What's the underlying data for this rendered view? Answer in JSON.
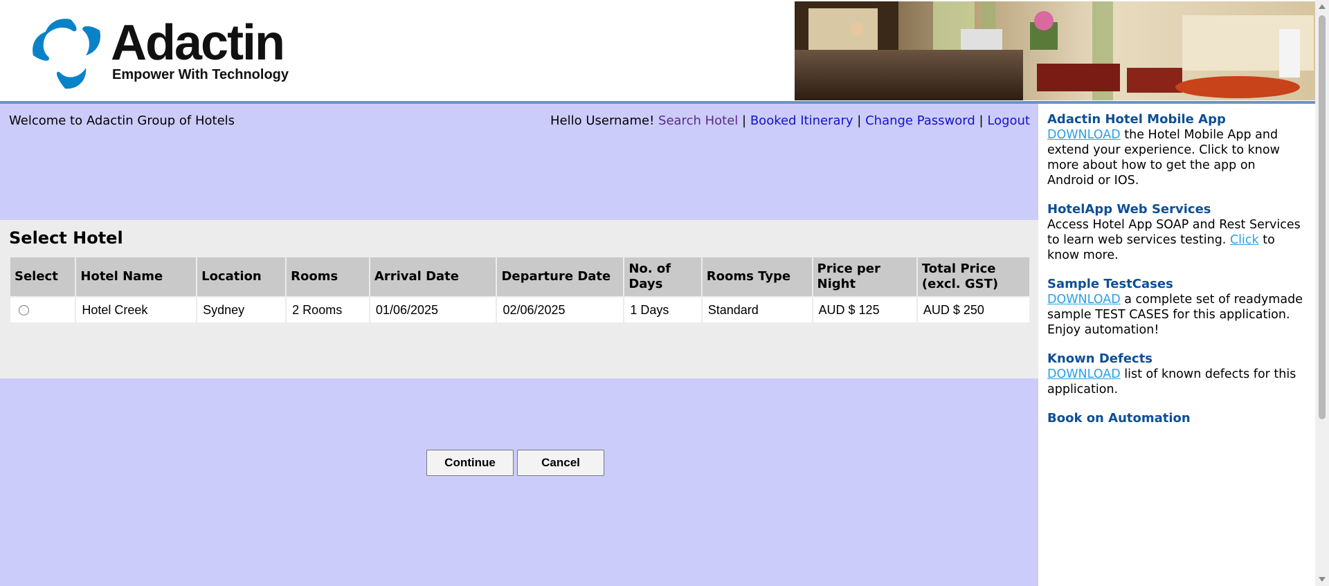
{
  "brand": {
    "name": "Adactin",
    "tagline": "Empower With Technology"
  },
  "header": {
    "welcome": "Welcome to Adactin Group of Hotels",
    "greeting": "Hello Username!",
    "nav": {
      "search_hotel": "Search Hotel",
      "booked_itinerary": "Booked Itinerary",
      "change_password": "Change Password",
      "logout": "Logout",
      "separator": "|"
    }
  },
  "select_hotel": {
    "title": "Select Hotel",
    "columns": {
      "select": "Select",
      "hotel_name": "Hotel Name",
      "location": "Location",
      "rooms": "Rooms",
      "arrival_date": "Arrival Date",
      "departure_date": "Departure Date",
      "no_of_days_1": "No. of",
      "no_of_days_2": "Days",
      "rooms_type": "Rooms Type",
      "price_per_night_1": "Price per",
      "price_per_night_2": "Night",
      "total_price_1": "Total Price",
      "total_price_2": "(excl. GST)"
    },
    "rows": [
      {
        "hotel_name": "Hotel Creek",
        "location": "Sydney",
        "rooms": "2 Rooms",
        "arrival_date": "01/06/2025",
        "departure_date": "02/06/2025",
        "no_of_days": "1 Days",
        "rooms_type": "Standard",
        "price_per_night": "AUD $ 125",
        "total_price": "AUD $ 250"
      }
    ],
    "buttons": {
      "continue": "Continue",
      "cancel": "Cancel"
    }
  },
  "sidebar": {
    "mobile_app": {
      "title": "Adactin Hotel Mobile App",
      "link": "DOWNLOAD",
      "text": " the Hotel Mobile App and extend your experience. Click to know more about how to get the app on Android or IOS."
    },
    "web_services": {
      "title": "HotelApp Web Services",
      "text_before": "Access Hotel App SOAP and Rest Services to learn web services testing. ",
      "link": "Click",
      "text_after": " to know more."
    },
    "test_cases": {
      "title": "Sample TestCases",
      "link": "DOWNLOAD",
      "text": " a complete set of readymade sample TEST CASES for this application. Enjoy automation!"
    },
    "known_defects": {
      "title": "Known Defects",
      "link": "DOWNLOAD",
      "text": " list of known defects for this application."
    },
    "book": {
      "title": "Book on Automation"
    }
  },
  "colors": {
    "main_bg": "#ccccfb",
    "panel_bg": "#ececec",
    "header_cell": "#c9c9c9",
    "sidebar_title": "#0d4f97",
    "sidebar_link": "#29a0e8",
    "nav_link": "#1212c8",
    "nav_visited": "#5a2a86"
  }
}
